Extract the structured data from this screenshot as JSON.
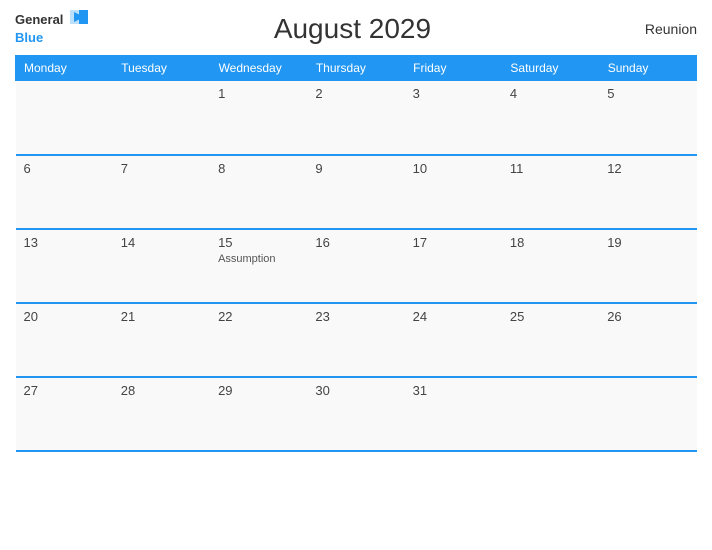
{
  "header": {
    "logo_general": "General",
    "logo_blue": "Blue",
    "title": "August 2029",
    "location": "Reunion"
  },
  "days_of_week": [
    "Monday",
    "Tuesday",
    "Wednesday",
    "Thursday",
    "Friday",
    "Saturday",
    "Sunday"
  ],
  "weeks": [
    [
      {
        "num": "",
        "event": ""
      },
      {
        "num": "",
        "event": ""
      },
      {
        "num": "1",
        "event": ""
      },
      {
        "num": "2",
        "event": ""
      },
      {
        "num": "3",
        "event": ""
      },
      {
        "num": "4",
        "event": ""
      },
      {
        "num": "5",
        "event": ""
      }
    ],
    [
      {
        "num": "6",
        "event": ""
      },
      {
        "num": "7",
        "event": ""
      },
      {
        "num": "8",
        "event": ""
      },
      {
        "num": "9",
        "event": ""
      },
      {
        "num": "10",
        "event": ""
      },
      {
        "num": "11",
        "event": ""
      },
      {
        "num": "12",
        "event": ""
      }
    ],
    [
      {
        "num": "13",
        "event": ""
      },
      {
        "num": "14",
        "event": ""
      },
      {
        "num": "15",
        "event": "Assumption"
      },
      {
        "num": "16",
        "event": ""
      },
      {
        "num": "17",
        "event": ""
      },
      {
        "num": "18",
        "event": ""
      },
      {
        "num": "19",
        "event": ""
      }
    ],
    [
      {
        "num": "20",
        "event": ""
      },
      {
        "num": "21",
        "event": ""
      },
      {
        "num": "22",
        "event": ""
      },
      {
        "num": "23",
        "event": ""
      },
      {
        "num": "24",
        "event": ""
      },
      {
        "num": "25",
        "event": ""
      },
      {
        "num": "26",
        "event": ""
      }
    ],
    [
      {
        "num": "27",
        "event": ""
      },
      {
        "num": "28",
        "event": ""
      },
      {
        "num": "29",
        "event": ""
      },
      {
        "num": "30",
        "event": ""
      },
      {
        "num": "31",
        "event": ""
      },
      {
        "num": "",
        "event": ""
      },
      {
        "num": "",
        "event": ""
      }
    ]
  ]
}
